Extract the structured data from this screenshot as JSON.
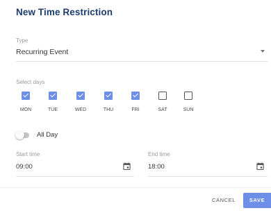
{
  "dialog": {
    "title": "New Time Restriction"
  },
  "type_field": {
    "label": "Type",
    "value": "Recurring Event"
  },
  "days": {
    "label": "Select days",
    "items": [
      {
        "label": "MON",
        "checked": true
      },
      {
        "label": "TUE",
        "checked": true
      },
      {
        "label": "WED",
        "checked": true
      },
      {
        "label": "THU",
        "checked": true
      },
      {
        "label": "FRI",
        "checked": true
      },
      {
        "label": "SAT",
        "checked": false
      },
      {
        "label": "SUN",
        "checked": false
      }
    ]
  },
  "all_day": {
    "label": "All Day",
    "on": false
  },
  "start_time": {
    "label": "Start time",
    "value": "09:00",
    "icon": "calendar-icon"
  },
  "end_time": {
    "label": "End time",
    "value": "18:00",
    "icon": "calendar-icon"
  },
  "actions": {
    "cancel_label": "CANCEL",
    "save_label": "SAVE"
  },
  "colors": {
    "accent": "#6e8fe8",
    "title": "#1d3c6e"
  }
}
